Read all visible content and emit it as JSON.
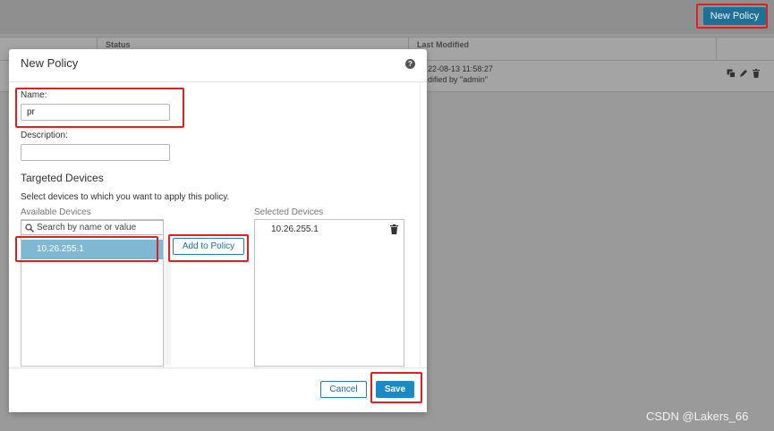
{
  "background": {
    "new_policy_button": "New Policy",
    "columns": {
      "status": "Status",
      "last_modified": "Last Modified"
    },
    "row": {
      "timestamp": "22-08-13 11:58:27",
      "modified_by": "dified by \"admin\""
    }
  },
  "modal": {
    "title": "New Policy",
    "help_icon": "?",
    "name_label": "Name:",
    "name_value": "pr",
    "description_label": "Description:",
    "description_value": "",
    "targeted_title": "Targeted Devices",
    "hint": "Select devices to which you want to apply this policy.",
    "available_label": "Available Devices",
    "search_placeholder": "Search by name or value",
    "available_devices": [
      "10.26.255.1"
    ],
    "add_button": "Add to Policy",
    "selected_label": "Selected Devices",
    "selected_devices": [
      "10.26.255.1"
    ],
    "cancel_button": "Cancel",
    "save_button": "Save"
  },
  "icons": [
    "copy-icon",
    "edit-icon",
    "trash-icon",
    "search-icon",
    "help-icon"
  ],
  "colors": {
    "primary": "#1b8ac4",
    "highlight": "#e02020",
    "selected_row": "#7fb8d3"
  },
  "watermark": "CSDN @Lakers_66"
}
